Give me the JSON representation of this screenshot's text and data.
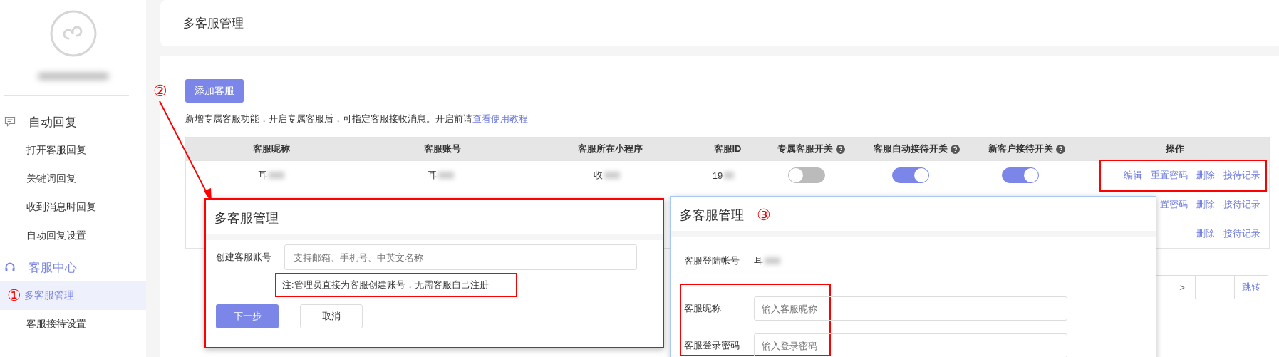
{
  "sidebar": {
    "groups": [
      {
        "label": "自动回复",
        "kind": "chat",
        "active": false,
        "children": [
          {
            "label": "打开客服回复",
            "selected": false
          },
          {
            "label": "关键词回复",
            "selected": false
          },
          {
            "label": "收到消息时回复",
            "selected": false
          },
          {
            "label": "自动回复设置",
            "selected": false
          }
        ]
      },
      {
        "label": "客服中心",
        "kind": "headset",
        "active": true,
        "children": [
          {
            "label": "多客服管理",
            "selected": true,
            "marker": "①"
          },
          {
            "label": "客服接待设置",
            "selected": false
          }
        ]
      }
    ]
  },
  "header": {
    "title": "多客服管理"
  },
  "add_button": "添加客服",
  "notice": {
    "text": "新增专属客服功能，开启专属客服后，可指定客服接收消息。开启前请",
    "link": "查看使用教程"
  },
  "arrow_marker": "②",
  "table": {
    "columns": [
      {
        "label": "客服昵称"
      },
      {
        "label": "客服账号"
      },
      {
        "label": "客服所在小程序"
      },
      {
        "label": "客服ID"
      },
      {
        "label": "专属客服开关",
        "help": true
      },
      {
        "label": "客服自动接待开关",
        "help": true
      },
      {
        "label": "新客户接待开关",
        "help": true
      },
      {
        "label": "操作"
      }
    ],
    "rows": [
      {
        "nickname": "耳",
        "account": "耳",
        "app": "收",
        "id": "19",
        "switches": [
          {
            "on": false
          },
          {
            "on": true
          },
          {
            "on": true
          }
        ],
        "actions": [
          "编辑",
          "重置密码",
          "删除",
          "接待记录"
        ]
      },
      {
        "actions": [
          "置密码",
          "删除",
          "接待记录"
        ]
      },
      {
        "actions": [
          "删除",
          "接待记录"
        ]
      }
    ]
  },
  "pagination": {
    "next": ">",
    "jump": "跳转"
  },
  "create_dialog": {
    "title": "多客服管理",
    "label": "创建客服账号",
    "placeholder": "支持邮箱、手机号、中英文名称",
    "note": "注:管理员直接为客服创建账号，无需客服自己注册",
    "buttons": [
      {
        "label": "下一步",
        "kind": "primary"
      },
      {
        "label": "取消",
        "kind": "default"
      }
    ]
  },
  "edit_dialog": {
    "title": "多客服管理",
    "marker": "③",
    "rows": [
      {
        "label": "客服登陆帐号",
        "kind": "value",
        "value": "耳"
      },
      {
        "label": "客服昵称",
        "kind": "input",
        "placeholder": "输入客服昵称"
      },
      {
        "label": "客服登录密码",
        "kind": "input",
        "placeholder": "输入登录密码"
      }
    ]
  }
}
